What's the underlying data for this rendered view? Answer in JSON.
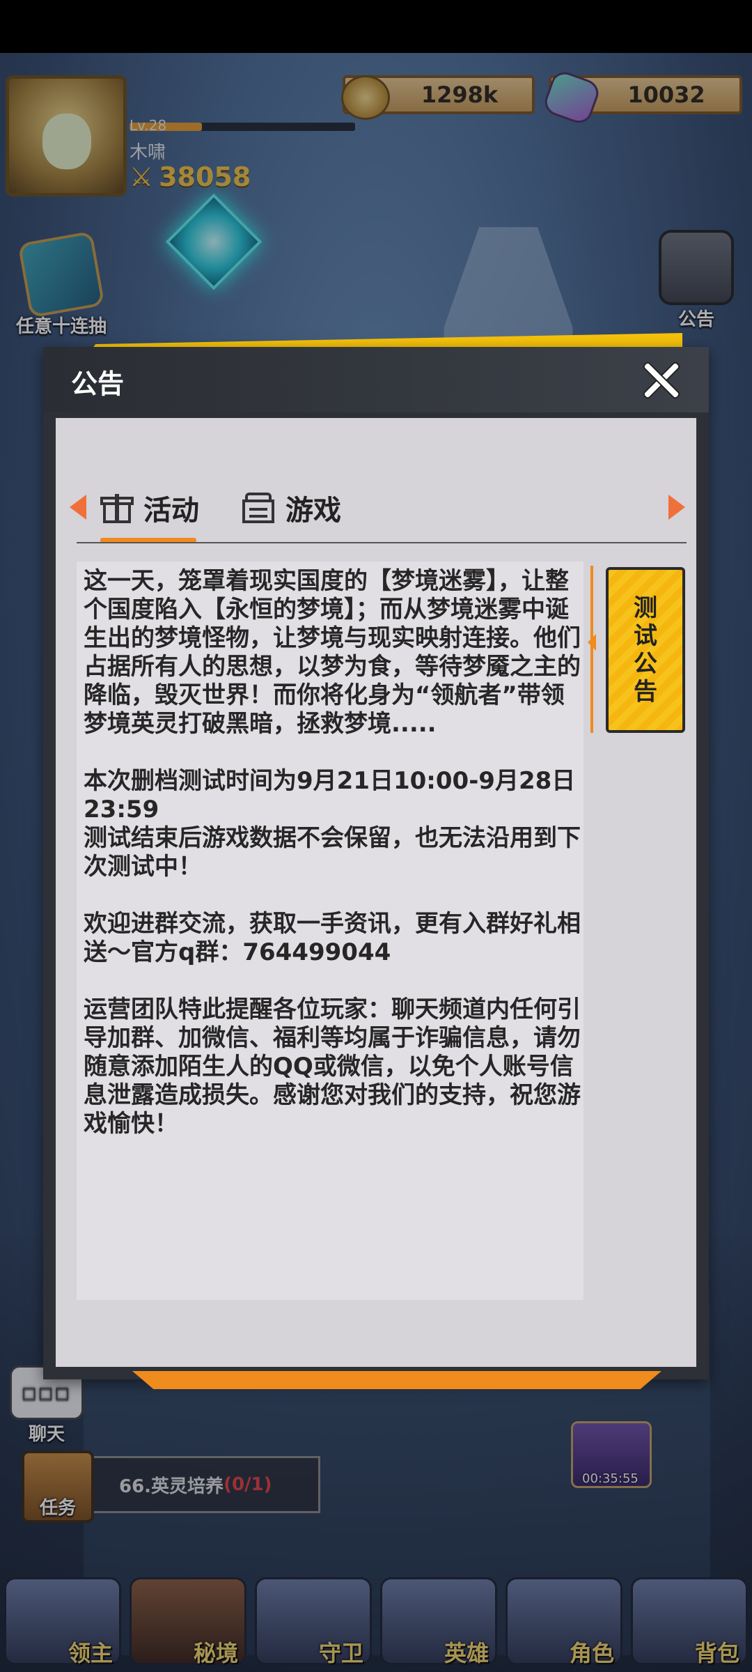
{
  "hud": {
    "level": "Lv.28",
    "xp_fraction": 0.32,
    "player_name": "木啸",
    "power": "38058",
    "gold": "1298k",
    "gems": "10032"
  },
  "side_buttons": {
    "ten_pull": "任意十连抽",
    "notice": "公告"
  },
  "chat": {
    "label": "聊天",
    "icon_text": "□□□"
  },
  "task": {
    "label": "任务",
    "quest": "66.英灵培养",
    "progress": "(0/1)"
  },
  "chest_timer": "00:35:55",
  "bottom_nav": [
    {
      "label": "领主"
    },
    {
      "label": "秘境"
    },
    {
      "label": "守卫"
    },
    {
      "label": "英雄"
    },
    {
      "label": "角色"
    },
    {
      "label": "背包"
    }
  ],
  "modal": {
    "title": "公告",
    "tabs": [
      {
        "label": "活动",
        "icon": "gift-icon",
        "active": true
      },
      {
        "label": "游戏",
        "icon": "document-icon",
        "active": false
      }
    ],
    "side_tab": "测试公告",
    "content": "这一天，笼罩着现实国度的【梦境迷雾】，让整个国度陷入【永恒的梦境】；而从梦境迷雾中诞生出的梦境怪物，让梦境与现实映射连接。他们占据所有人的思想，以梦为食，等待梦魇之主的降临，毁灭世界！而你将化身为“领航者”带领梦境英灵打破黑暗，拯救梦境.....\n\n本次删档测试时间为9月21日10:00-9月28日23:59\n测试结束后游戏数据不会保留，也无法沿用到下次测试中！\n\n欢迎进群交流，获取一手资讯，更有入群好礼相送～官方q群：764499044\n\n运营团队特此提醒各位玩家：聊天频道内任何引导加群、加微信、福利等均属于诈骗信息，请勿随意添加陌生人的QQ或微信，以免个人账号信息泄露造成损失。感谢您对我们的支持，祝您游戏愉快！"
  },
  "colors": {
    "accent_orange": "#f08b1d",
    "accent_yellow": "#f6c20b",
    "modal_dark": "#2d3037",
    "panel_light": "#d6d3d9"
  }
}
